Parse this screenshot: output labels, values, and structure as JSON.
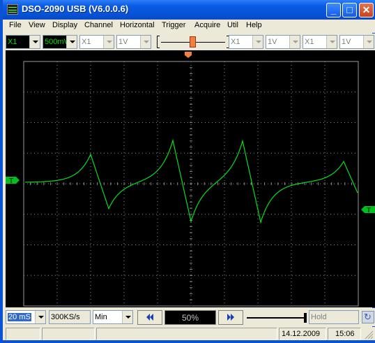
{
  "window": {
    "title": "DSO-2090 USB (V6.0.0.6)"
  },
  "menu": [
    "File",
    "View",
    "Display",
    "Channel",
    "Horizontal",
    "Trigger",
    "Acquire",
    "Util",
    "Help"
  ],
  "toolbar": {
    "ch1_probe": "X1",
    "ch1_voltdiv": "500mV",
    "ch2_probe": "X1",
    "ch2_voltdiv": "1V",
    "ch3_probe": "X1",
    "ch3_voltdiv": "1V",
    "ch4_probe": "X1",
    "ch4_voltdiv": "1V"
  },
  "scope": {
    "trace_color": "#00e020",
    "grid_color": "#8a8a8a",
    "left_marker": "T",
    "right_marker": "T",
    "trigger_level_marker_color": "#00c020",
    "trigger_position_marker_color": "#f08040"
  },
  "controls": {
    "timebase": "20 mS",
    "sample_rate": "300KS/s",
    "acq_mode": "Min",
    "position": "50%",
    "hold_label": "Hold"
  },
  "status": {
    "date": "14.12.2009",
    "time": "15:06"
  }
}
